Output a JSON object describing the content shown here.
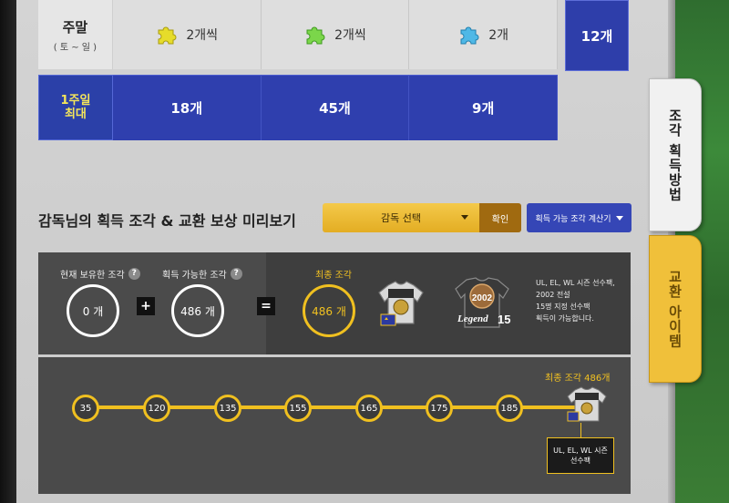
{
  "rewards_table": {
    "weekend": {
      "day": "주말",
      "day_range": "( 토 ~ 일 )",
      "counts": [
        "2개씩",
        "2개씩",
        "2개"
      ],
      "puzzle_colors": [
        "#e6dc2a",
        "#7bd64a",
        "#4fb8e6"
      ]
    },
    "weekly_max": {
      "label_line1": "1주일",
      "label_line2": "최대",
      "values": [
        "18개",
        "45개",
        "9개"
      ]
    },
    "side_total": "12개"
  },
  "tabs": {
    "acquisition": "조각 획득방법",
    "exchange": "교환 아이템"
  },
  "section": {
    "title": "감독님의 획득 조각 &  교환 보상 미리보기",
    "select_label": "감독 선택",
    "confirm_label": "확인",
    "calc_label": "획득 가능 조각 계산기"
  },
  "summary": {
    "owned_label": "현재 보유한 조각",
    "owned_value": "0 개",
    "available_label": "획득 가능한 조각",
    "available_value": "486 개",
    "plus": "+",
    "equals": "=",
    "final_label": "최종 조각",
    "final_value": "486 개",
    "legend_card": {
      "year": "2002",
      "text": "Legend",
      "num": "15"
    },
    "description": [
      "UL, EL, WL 시즌 선수팩,",
      "2002 전설",
      "15명 지정 선수팩",
      "획득이 가능합니다."
    ]
  },
  "timeline": {
    "caption": "최종 조각 486개",
    "nodes": [
      "35",
      "120",
      "135",
      "155",
      "165",
      "175",
      "185"
    ],
    "reward_text": "UL, EL, WL 시즌 선수팩"
  },
  "colors": {
    "accent_gold": "#f0c020",
    "navy": "#2f3fae"
  }
}
